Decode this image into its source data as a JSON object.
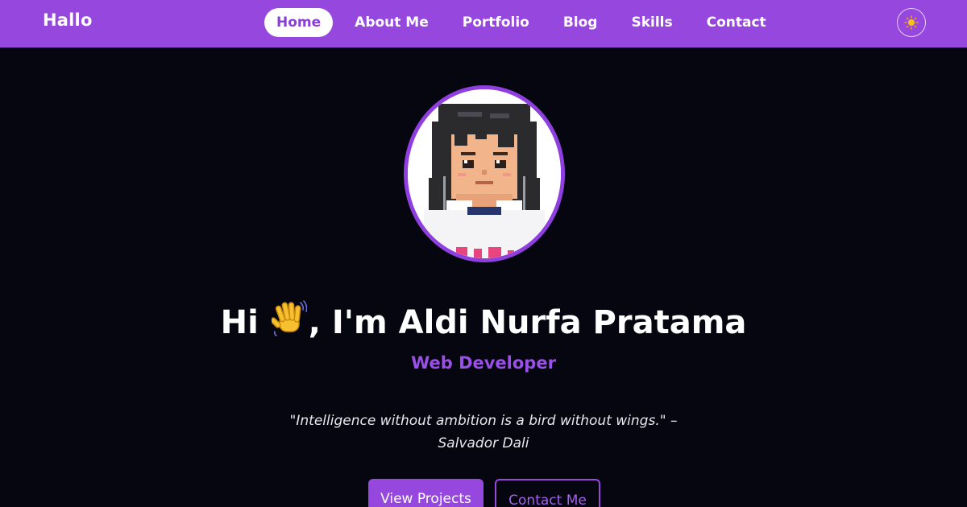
{
  "navbar": {
    "brand": "Hallo",
    "links": [
      {
        "label": "Home",
        "active": true
      },
      {
        "label": "About Me"
      },
      {
        "label": "Portfolio"
      },
      {
        "label": "Blog"
      },
      {
        "label": "Skills"
      },
      {
        "label": "Contact"
      }
    ],
    "theme_toggle_icon": "sun-icon"
  },
  "hero": {
    "greeting_pre": "Hi",
    "wave_icon": "waving-hand-icon",
    "greeting_post": ", I'm Aldi Nurfa Pratama",
    "role": "Web Developer",
    "quote_line1": "\"Intelligence without ambition is a bird without wings.\" –",
    "quote_line2": "Salvador Dali",
    "primary_button": "View Projects",
    "secondary_button": "Contact Me"
  },
  "colors": {
    "accent": "#9648de",
    "background": "#05060f",
    "text": "#ffffff"
  }
}
